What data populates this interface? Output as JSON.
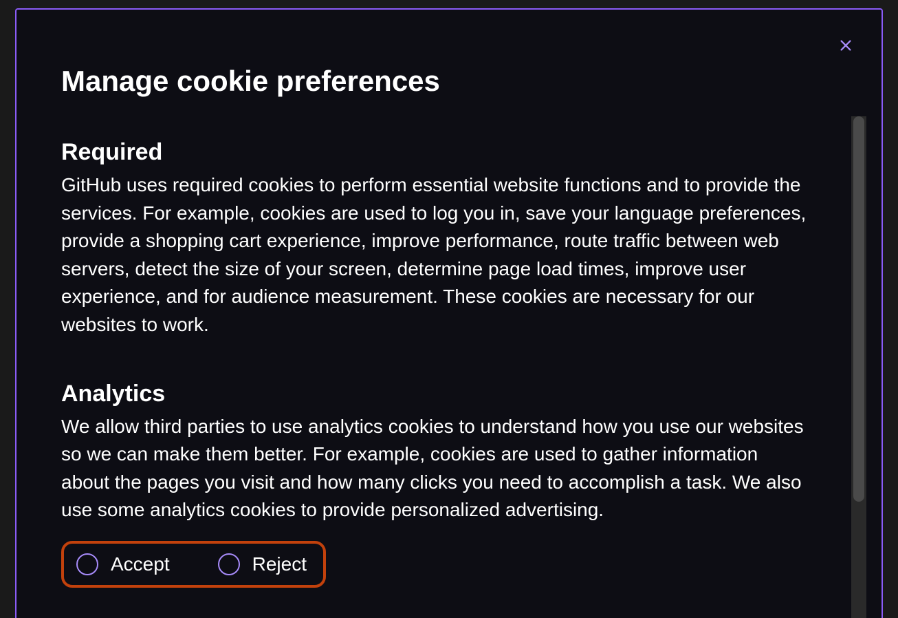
{
  "dialog": {
    "title": "Manage cookie preferences",
    "sections": {
      "required": {
        "title": "Required",
        "description": "GitHub uses required cookies to perform essential website functions and to provide the services. For example, cookies are used to log you in, save your language preferences, provide a shopping cart experience, improve performance, route traffic between web servers, detect the size of your screen, determine page load times, improve user experience, and for audience measurement. These cookies are necessary for our websites to work."
      },
      "analytics": {
        "title": "Analytics",
        "description": "We allow third parties to use analytics cookies to understand how you use our websites so we can make them better. For example, cookies are used to gather information about the pages you visit and how many clicks you need to accomplish a task. We also use some analytics cookies to provide personalized advertising.",
        "options": {
          "accept": "Accept",
          "reject": "Reject"
        }
      }
    }
  }
}
